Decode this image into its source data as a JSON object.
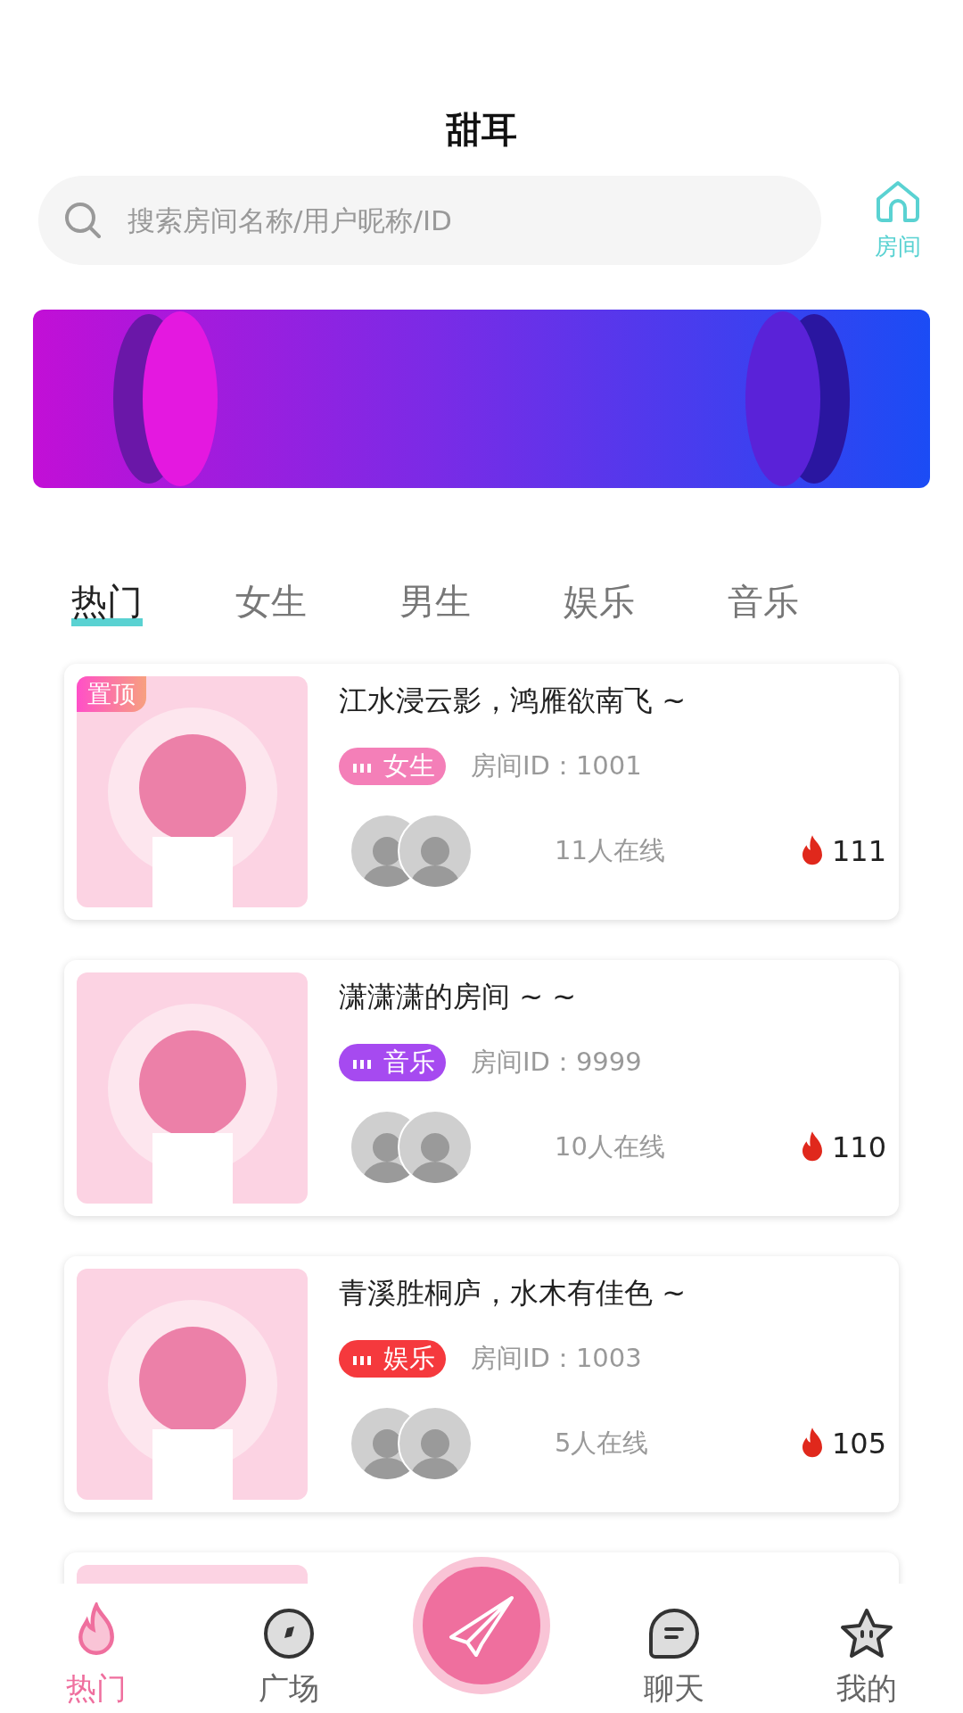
{
  "title": "甜耳",
  "search": {
    "placeholder": "搜索房间名称/用户昵称/ID"
  },
  "room_button": {
    "label": "房间"
  },
  "tabs": [
    {
      "label": "热门",
      "selected": true
    },
    {
      "label": "女生",
      "selected": false
    },
    {
      "label": "男生",
      "selected": false
    },
    {
      "label": "娱乐",
      "selected": false
    },
    {
      "label": "音乐",
      "selected": false
    }
  ],
  "rooms": [
    {
      "pinned": true,
      "pin_label": "置顶",
      "title": "江水浸云影，鸿雁欲南飞 ~",
      "tag": "女生",
      "color": "#f47fb8",
      "room_id": "房间ID：1001",
      "online": "11人在线",
      "heat": "111"
    },
    {
      "pinned": false,
      "title": "潇潇潇的房间 ~ ~",
      "tag": "音乐",
      "color": "#a64af0",
      "room_id": "房间ID：9999",
      "online": "10人在线",
      "heat": "110"
    },
    {
      "pinned": false,
      "title": "青溪胜桐庐，水木有佳色 ~",
      "tag": "娱乐",
      "color": "#f5393d",
      "room_id": "房间ID：1003",
      "online": "5人在线",
      "heat": "105"
    }
  ],
  "nav": [
    {
      "kind": "flame",
      "label": "热门",
      "selected": true
    },
    {
      "kind": "compass",
      "label": "广场",
      "selected": false
    },
    {
      "kind": "plane",
      "selected": false
    },
    {
      "kind": "chat",
      "label": "聊天",
      "selected": false
    },
    {
      "kind": "star",
      "label": "我的",
      "selected": false
    }
  ]
}
